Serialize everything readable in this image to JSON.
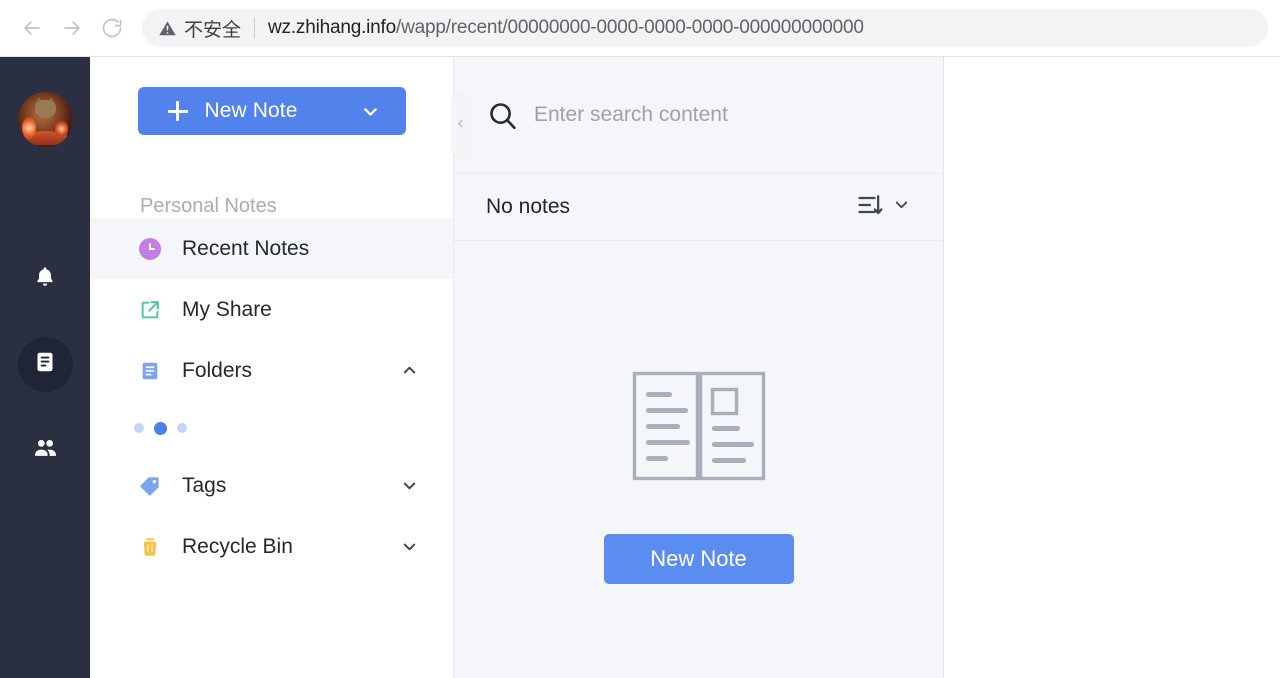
{
  "browser": {
    "back_icon": "arrow-left-icon",
    "forward_icon": "arrow-right-icon",
    "reload_icon": "reload-icon",
    "security_warning_icon": "warning-triangle-icon",
    "security_label": "不安全",
    "url_host": "wz.zhihang.info",
    "url_path": "/wapp/recent/00000000-0000-0000-0000-000000000000"
  },
  "rail": {
    "avatar": "user-avatar",
    "items": [
      {
        "name": "bell-icon",
        "label": "Notifications",
        "active": false
      },
      {
        "name": "note-icon",
        "label": "Notes",
        "active": true
      },
      {
        "name": "team-icon",
        "label": "Team",
        "active": false
      }
    ]
  },
  "nav": {
    "new_note_label": "New Note",
    "new_note_plus_icon": "plus-icon",
    "new_note_caret_icon": "chevron-down-icon",
    "section_title": "Personal Notes",
    "collapse_icon": "chevron-left-icon",
    "items": [
      {
        "label": "Recent Notes",
        "icon": "clock-icon",
        "selected": true,
        "caret": ""
      },
      {
        "label": "My Share",
        "icon": "share-external-icon",
        "selected": false,
        "caret": ""
      },
      {
        "label": "Folders",
        "icon": "folder-doc-icon",
        "selected": false,
        "caret": "chevron-up-icon"
      },
      {
        "label": "Tags",
        "icon": "tag-icon",
        "selected": false,
        "caret": "chevron-down-icon"
      },
      {
        "label": "Recycle Bin",
        "icon": "trash-icon",
        "selected": false,
        "caret": "chevron-down-icon"
      }
    ],
    "loading_dots": 3
  },
  "note_list": {
    "search_placeholder": "Enter search content",
    "search_value": "",
    "search_icon": "search-icon",
    "count_label": "No notes",
    "sort_icon": "sort-descending-icon",
    "sort_caret_icon": "chevron-down-icon",
    "empty_illustration": "open-book-icon",
    "empty_button_label": "New Note"
  },
  "colors": {
    "accent_blue": "#5282eb",
    "empty_button_blue": "#5b8cf0",
    "rail_dark": "#2a3042",
    "rail_active": "#1f2537",
    "clock_purple": "#c47ee0",
    "share_green": "#4cc98a",
    "folder_blue": "#7aa5f2",
    "tag_blue": "#7aa5f2",
    "trash_yellow": "#f5c443",
    "panel_gray": "#f4f6f9"
  }
}
